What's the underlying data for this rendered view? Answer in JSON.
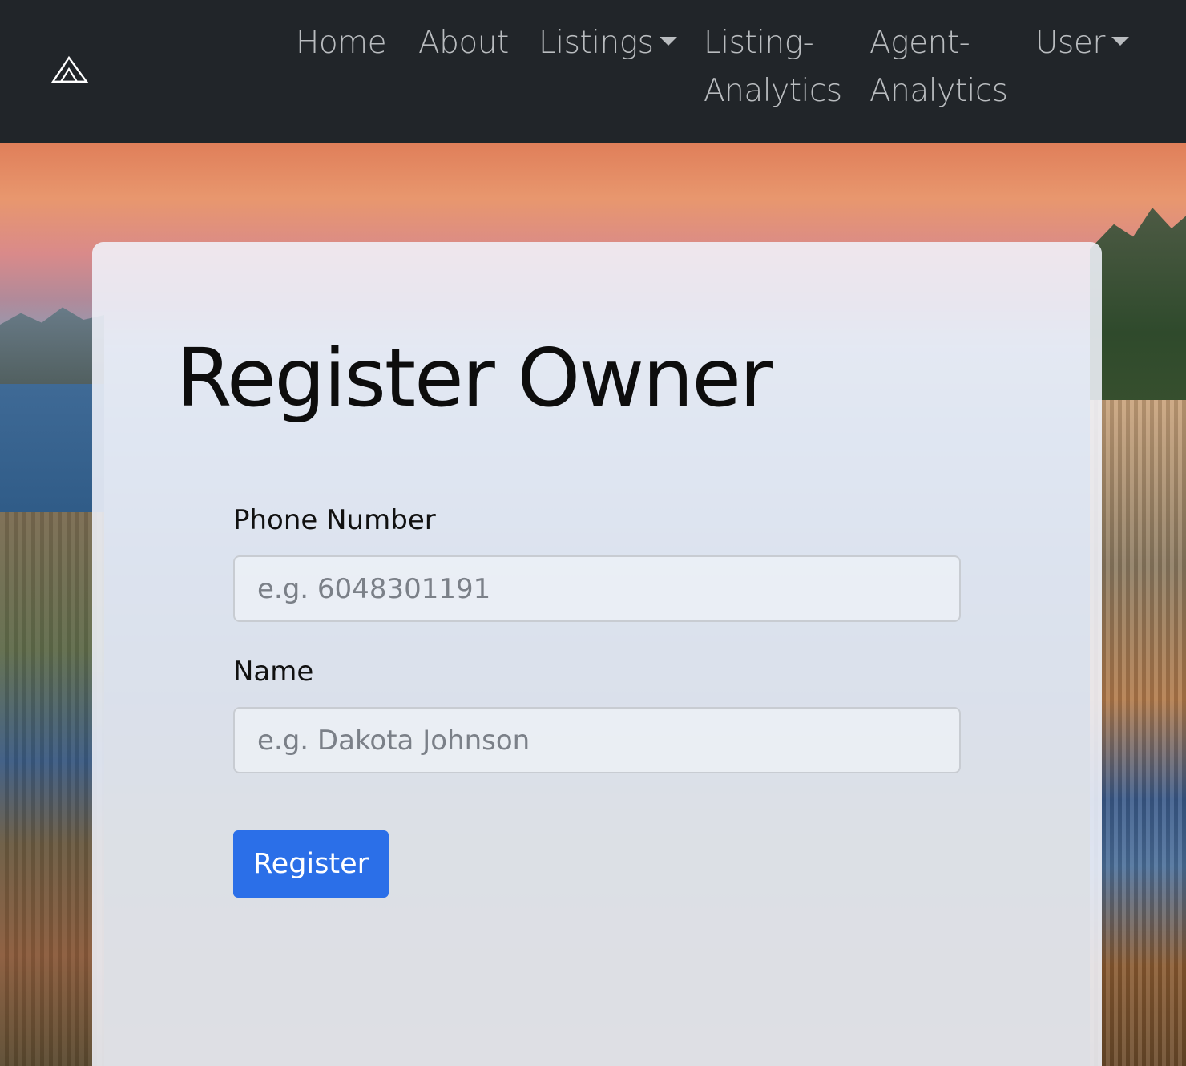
{
  "navbar": {
    "brand_icon": "mountain-logo-icon",
    "items": [
      {
        "label": "Home"
      },
      {
        "label": "About"
      },
      {
        "label": "Listings",
        "dropdown": true
      },
      {
        "label_line1": "Listing-",
        "label_line2": "Analytics"
      },
      {
        "label_line1": "Agent-",
        "label_line2": "Analytics"
      },
      {
        "label": "User",
        "dropdown": true
      }
    ]
  },
  "form": {
    "title": "Register Owner",
    "phone": {
      "label": "Phone Number",
      "placeholder": "e.g. 6048301191",
      "value": ""
    },
    "name": {
      "label": "Name",
      "placeholder": "e.g. Dakota Johnson",
      "value": ""
    },
    "submit_label": "Register"
  },
  "colors": {
    "navbar_bg": "#212529",
    "nav_text": "#b9bcbf",
    "primary_button": "#2b6fe8",
    "card_bg": "#f0f3fa"
  }
}
